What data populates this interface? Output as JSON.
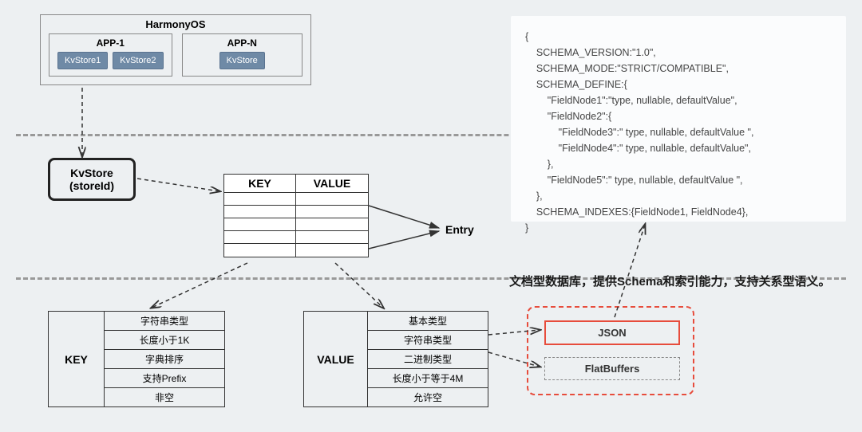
{
  "harmony_os": {
    "title": "HarmonyOS",
    "apps": [
      {
        "name": "APP-1",
        "stores": [
          "KvStore1",
          "KvStore2"
        ]
      },
      {
        "name": "APP-N",
        "stores": [
          "KvStore"
        ]
      }
    ]
  },
  "kvstore_main": {
    "line1": "KvStore",
    "line2": "(storeId)"
  },
  "kv_table": {
    "headers": [
      "KEY",
      "VALUE"
    ]
  },
  "entry_label": "Entry",
  "key_detail": {
    "label": "KEY",
    "rows": [
      "字符串类型",
      "长度小于1K",
      "字典排序",
      "支持Prefix",
      "非空"
    ]
  },
  "value_detail": {
    "label": "VALUE",
    "rows": [
      "基本类型",
      "字符串类型",
      "二进制类型",
      "长度小于等于4M",
      "允许空"
    ]
  },
  "schema_text": "{\n    SCHEMA_VERSION:\"1.0\",\n    SCHEMA_MODE:\"STRICT/COMPATIBLE\",\n    SCHEMA_DEFINE:{\n        \"FieldNode1\":\"type, nullable, defaultValue\",\n        \"FieldNode2\":{\n            \"FieldNode3\":\" type, nullable, defaultValue \",\n            \"FieldNode4\":\" type, nullable, defaultValue\",\n        },\n        \"FieldNode5\":\" type, nullable, defaultValue \",\n    },\n    SCHEMA_INDEXES:{FieldNode1, FieldNode4},\n}",
  "annotation": "文档型数据库，提供Schema和索引能力，支持关系型语义。",
  "formats": {
    "json": "JSON",
    "flatbuffers": "FlatBuffers"
  }
}
